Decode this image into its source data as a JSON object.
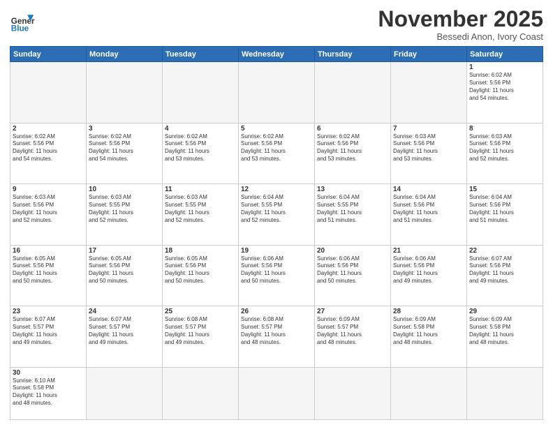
{
  "logo": {
    "general": "General",
    "blue": "Blue"
  },
  "header": {
    "month": "November 2025",
    "location": "Bessedi Anon, Ivory Coast"
  },
  "days_of_week": [
    "Sunday",
    "Monday",
    "Tuesday",
    "Wednesday",
    "Thursday",
    "Friday",
    "Saturday"
  ],
  "weeks": [
    [
      {
        "day": "",
        "info": ""
      },
      {
        "day": "",
        "info": ""
      },
      {
        "day": "",
        "info": ""
      },
      {
        "day": "",
        "info": ""
      },
      {
        "day": "",
        "info": ""
      },
      {
        "day": "",
        "info": ""
      },
      {
        "day": "1",
        "info": "Sunrise: 6:02 AM\nSunset: 5:56 PM\nDaylight: 11 hours\nand 54 minutes."
      }
    ],
    [
      {
        "day": "2",
        "info": "Sunrise: 6:02 AM\nSunset: 5:56 PM\nDaylight: 11 hours\nand 54 minutes."
      },
      {
        "day": "3",
        "info": "Sunrise: 6:02 AM\nSunset: 5:56 PM\nDaylight: 11 hours\nand 54 minutes."
      },
      {
        "day": "4",
        "info": "Sunrise: 6:02 AM\nSunset: 5:56 PM\nDaylight: 11 hours\nand 53 minutes."
      },
      {
        "day": "5",
        "info": "Sunrise: 6:02 AM\nSunset: 5:56 PM\nDaylight: 11 hours\nand 53 minutes."
      },
      {
        "day": "6",
        "info": "Sunrise: 6:02 AM\nSunset: 5:56 PM\nDaylight: 11 hours\nand 53 minutes."
      },
      {
        "day": "7",
        "info": "Sunrise: 6:03 AM\nSunset: 5:56 PM\nDaylight: 11 hours\nand 53 minutes."
      },
      {
        "day": "8",
        "info": "Sunrise: 6:03 AM\nSunset: 5:56 PM\nDaylight: 11 hours\nand 52 minutes."
      }
    ],
    [
      {
        "day": "9",
        "info": "Sunrise: 6:03 AM\nSunset: 5:56 PM\nDaylight: 11 hours\nand 52 minutes."
      },
      {
        "day": "10",
        "info": "Sunrise: 6:03 AM\nSunset: 5:55 PM\nDaylight: 11 hours\nand 52 minutes."
      },
      {
        "day": "11",
        "info": "Sunrise: 6:03 AM\nSunset: 5:55 PM\nDaylight: 11 hours\nand 52 minutes."
      },
      {
        "day": "12",
        "info": "Sunrise: 6:04 AM\nSunset: 5:55 PM\nDaylight: 11 hours\nand 52 minutes."
      },
      {
        "day": "13",
        "info": "Sunrise: 6:04 AM\nSunset: 5:55 PM\nDaylight: 11 hours\nand 51 minutes."
      },
      {
        "day": "14",
        "info": "Sunrise: 6:04 AM\nSunset: 5:56 PM\nDaylight: 11 hours\nand 51 minutes."
      },
      {
        "day": "15",
        "info": "Sunrise: 6:04 AM\nSunset: 5:56 PM\nDaylight: 11 hours\nand 51 minutes."
      }
    ],
    [
      {
        "day": "16",
        "info": "Sunrise: 6:05 AM\nSunset: 5:56 PM\nDaylight: 11 hours\nand 50 minutes."
      },
      {
        "day": "17",
        "info": "Sunrise: 6:05 AM\nSunset: 5:56 PM\nDaylight: 11 hours\nand 50 minutes."
      },
      {
        "day": "18",
        "info": "Sunrise: 6:05 AM\nSunset: 5:56 PM\nDaylight: 11 hours\nand 50 minutes."
      },
      {
        "day": "19",
        "info": "Sunrise: 6:06 AM\nSunset: 5:56 PM\nDaylight: 11 hours\nand 50 minutes."
      },
      {
        "day": "20",
        "info": "Sunrise: 6:06 AM\nSunset: 5:56 PM\nDaylight: 11 hours\nand 50 minutes."
      },
      {
        "day": "21",
        "info": "Sunrise: 6:06 AM\nSunset: 5:56 PM\nDaylight: 11 hours\nand 49 minutes."
      },
      {
        "day": "22",
        "info": "Sunrise: 6:07 AM\nSunset: 5:56 PM\nDaylight: 11 hours\nand 49 minutes."
      }
    ],
    [
      {
        "day": "23",
        "info": "Sunrise: 6:07 AM\nSunset: 5:57 PM\nDaylight: 11 hours\nand 49 minutes."
      },
      {
        "day": "24",
        "info": "Sunrise: 6:07 AM\nSunset: 5:57 PM\nDaylight: 11 hours\nand 49 minutes."
      },
      {
        "day": "25",
        "info": "Sunrise: 6:08 AM\nSunset: 5:57 PM\nDaylight: 11 hours\nand 49 minutes."
      },
      {
        "day": "26",
        "info": "Sunrise: 6:08 AM\nSunset: 5:57 PM\nDaylight: 11 hours\nand 48 minutes."
      },
      {
        "day": "27",
        "info": "Sunrise: 6:09 AM\nSunset: 5:57 PM\nDaylight: 11 hours\nand 48 minutes."
      },
      {
        "day": "28",
        "info": "Sunrise: 6:09 AM\nSunset: 5:58 PM\nDaylight: 11 hours\nand 48 minutes."
      },
      {
        "day": "29",
        "info": "Sunrise: 6:09 AM\nSunset: 5:58 PM\nDaylight: 11 hours\nand 48 minutes."
      }
    ],
    [
      {
        "day": "30",
        "info": "Sunrise: 6:10 AM\nSunset: 5:58 PM\nDaylight: 11 hours\nand 48 minutes."
      },
      {
        "day": "",
        "info": ""
      },
      {
        "day": "",
        "info": ""
      },
      {
        "day": "",
        "info": ""
      },
      {
        "day": "",
        "info": ""
      },
      {
        "day": "",
        "info": ""
      },
      {
        "day": "",
        "info": ""
      }
    ]
  ]
}
